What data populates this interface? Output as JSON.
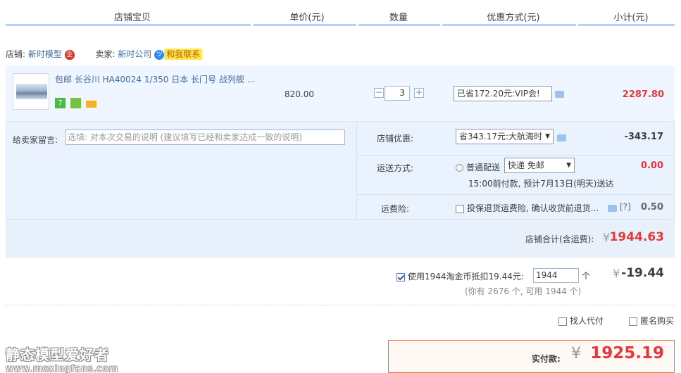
{
  "header": {
    "columns": [
      "店铺宝贝",
      "单价(元)",
      "数量",
      "优惠方式(元)",
      "小计(元)"
    ]
  },
  "shop": {
    "shop_label": "店铺:",
    "shop_name": "新时模型",
    "seller_label": "卖家:",
    "seller_name": "新时公司",
    "contact": "和我联系"
  },
  "item": {
    "title": "包邮 长谷川 HA40024 1/350 日本 长门号 战列舰 ...",
    "price": "820.00",
    "qty_minus": "−",
    "quantity": "3",
    "qty_plus": "+",
    "discount": "已省172.20元:VIP会!",
    "subtotal": "2287.80"
  },
  "message": {
    "label": "给卖家留言:",
    "placeholder": "选填: 对本次交易的说明 (建议填写已经和卖家达成一致的说明)"
  },
  "shop_discount": {
    "label": "店铺优惠:",
    "selected": "省343.17元:大航海时",
    "value": "-343.17"
  },
  "shipping": {
    "label": "运送方式:",
    "option": "普通配送",
    "selected": "快递 免邮",
    "note": "15:00前付款, 预计7月13日(明天)送达",
    "value": "0.00"
  },
  "insurance": {
    "label": "运费险:",
    "text": "投保退货运费险, 确认收货前退货...",
    "help": "[?]",
    "value": "0.50"
  },
  "shop_total": {
    "label": "店铺合计(含运费):",
    "currency": "¥",
    "value": "1944.63"
  },
  "coins": {
    "text": "使用1944淘金币抵扣19.44元:",
    "input": "1944",
    "unit": "个",
    "note": "(你有 2676 个, 可用 1944 个)",
    "currency": "¥",
    "value": "-19.44"
  },
  "options": {
    "proxy": "找人代付",
    "anonymous": "匿名购买"
  },
  "payment": {
    "label": "实付款:",
    "currency": "¥",
    "value": "1925.19"
  },
  "watermark": {
    "line1": "静态模型爱好者",
    "line2": "www.moxingfans.com"
  },
  "colors": {
    "accent_blue": "#3a6aa8",
    "price_red": "#e4393c",
    "pay_border": "#f06d2a"
  }
}
